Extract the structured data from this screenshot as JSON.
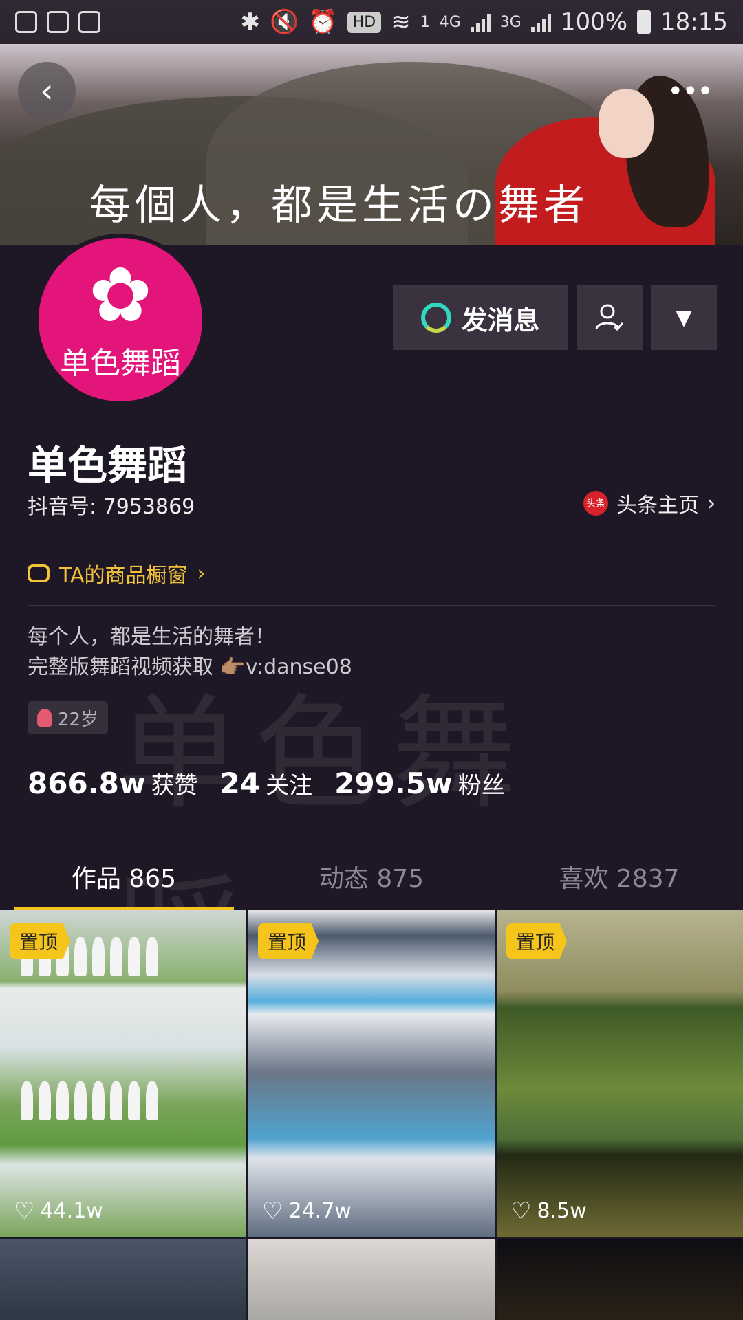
{
  "status_bar": {
    "battery": "100%",
    "time": "18:15",
    "hd": "HD",
    "net1": "4G",
    "net2": "3G",
    "sim": "1"
  },
  "banner": {
    "text": "每個人，都是生活の舞者"
  },
  "profile": {
    "avatar_text": "单色舞蹈",
    "name": "单色舞蹈",
    "douyin_id": "抖音号: 7953869",
    "toutiao_badge": "头条",
    "toutiao_label": "头条主页",
    "shop_label": "TA的商品橱窗",
    "bio_line1": "每个人，都是生活的舞者！",
    "bio_line2": "完整版舞蹈视频获取 👉🏽v:danse08",
    "age": "22岁"
  },
  "buttons": {
    "message": "发消息"
  },
  "stats": [
    {
      "num": "866.8w",
      "label": "获赞"
    },
    {
      "num": "24",
      "label": "关注"
    },
    {
      "num": "299.5w",
      "label": "粉丝"
    }
  ],
  "tabs": [
    {
      "label": "作品 865"
    },
    {
      "label": "动态 875"
    },
    {
      "label": "喜欢 2837"
    }
  ],
  "grid": [
    {
      "pinned": "置顶",
      "likes": "44.1w"
    },
    {
      "pinned": "置顶",
      "likes": "24.7w"
    },
    {
      "pinned": "置顶",
      "likes": "8.5w"
    }
  ],
  "colors": {
    "accent": "#f5c51b",
    "avatar_bg": "#e3147a",
    "page_bg": "#1e1725"
  }
}
